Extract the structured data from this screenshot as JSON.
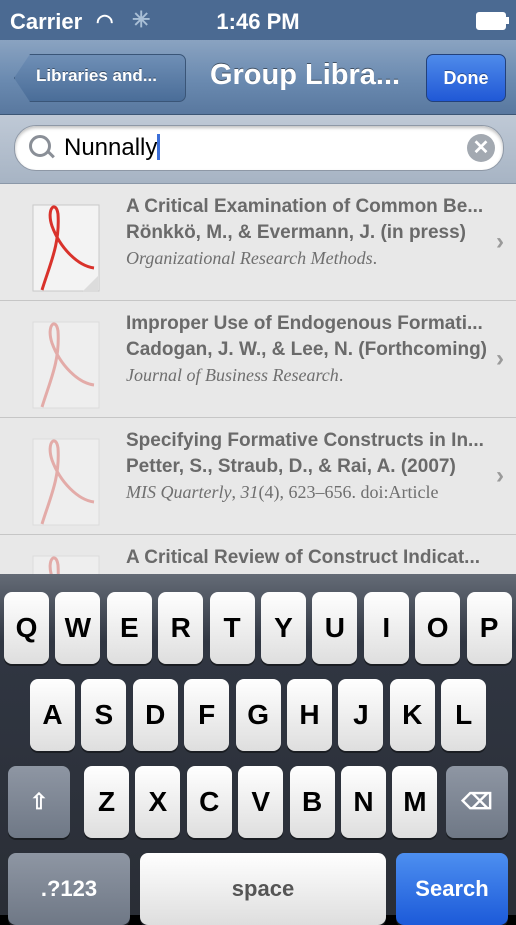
{
  "status_bar": {
    "carrier": "Carrier",
    "time": "1:46 PM"
  },
  "nav": {
    "back_label": "Libraries and...",
    "title": "Group Libra...",
    "done_label": "Done"
  },
  "search": {
    "value": "Nunnally"
  },
  "results": [
    {
      "title": "A Critical Examination of Common Be...",
      "authors": "Rönkkö, M.,  & Evermann, J. (in press)",
      "journal": "Organizational Research Methods",
      "journal_rest": "."
    },
    {
      "title": "Improper Use of Endogenous Formati...",
      "authors": "Cadogan, J. W.,  & Lee, N. (Forthcoming)",
      "journal": "Journal of Business Research",
      "journal_rest": "."
    },
    {
      "title": "Specifying Formative Constructs in In...",
      "authors": "Petter, S., Straub, D.,  & Rai, A. (2007)",
      "journal": "MIS Quarterly",
      "journal_rest": ", 31(4), 623–656. doi:Article"
    },
    {
      "title": "A Critical Review of Construct Indicat...",
      "authors": "",
      "journal": "",
      "journal_rest": ""
    }
  ],
  "keyboard": {
    "row1": [
      "Q",
      "W",
      "E",
      "R",
      "T",
      "Y",
      "U",
      "I",
      "O",
      "P"
    ],
    "row2": [
      "A",
      "S",
      "D",
      "F",
      "G",
      "H",
      "J",
      "K",
      "L"
    ],
    "row3": [
      "Z",
      "X",
      "C",
      "V",
      "B",
      "N",
      "M"
    ],
    "numbers_label": ".?123",
    "space_label": "space",
    "search_label": "Search"
  },
  "colors": {
    "nav_bar": "#6a8ab0",
    "done_button": "#2f6ee0",
    "search_key": "#1c5ad9",
    "pdf_icon_red": "#d9322b"
  }
}
